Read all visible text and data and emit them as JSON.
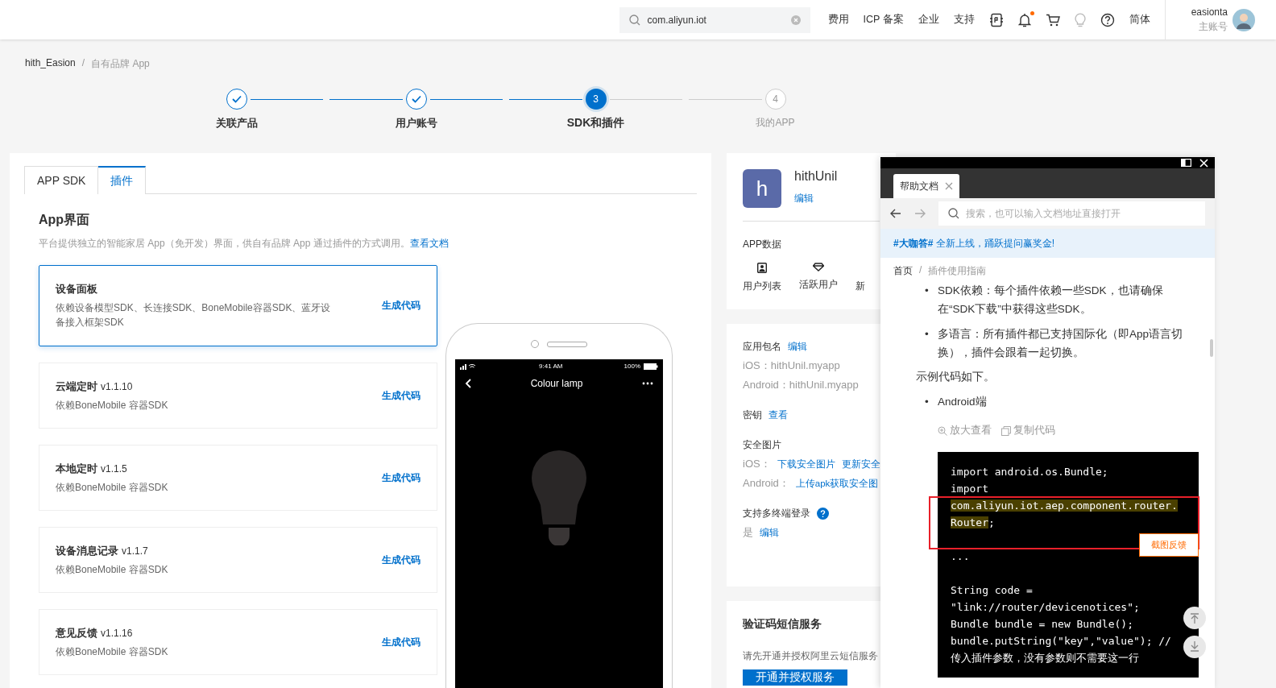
{
  "topbar": {
    "search": {
      "value": "com.aliyun.iot"
    },
    "nav": [
      "费用",
      "ICP 备案",
      "企业",
      "支持"
    ],
    "notification_dot": true,
    "language": "简体",
    "user": {
      "name": "easionta",
      "role": "主账号"
    }
  },
  "breadcrumb": {
    "items": [
      "hith_Easion",
      "自有品牌 App"
    ],
    "separator": "/"
  },
  "steps": [
    {
      "label": "关联产品",
      "kind": "done"
    },
    {
      "label": "用户账号",
      "kind": "done"
    },
    {
      "label": "SDK和插件",
      "kind": "active",
      "number": "3"
    },
    {
      "label": "我的APP",
      "kind": "pending",
      "number": "4"
    }
  ],
  "main": {
    "tabs": [
      {
        "label": "APP SDK",
        "selected": false
      },
      {
        "label": "插件",
        "selected": true
      }
    ],
    "title": "App界面",
    "description": "平台提供独立的智能家居 App（免开发）界面，供自有品牌 App 通过插件的方式调用。",
    "doc_link": "查看文档",
    "plugins": [
      {
        "name": "设备面板",
        "desc": "依赖设备模型SDK、长连接SDK、BoneMobile容器SDK、蓝牙设备接入框架SDK",
        "action": "生成代码",
        "selected": true
      },
      {
        "name": "云端定时",
        "version": "v1.1.10",
        "desc": "依赖BoneMobile 容器SDK",
        "action": "生成代码",
        "selected": false
      },
      {
        "name": "本地定时",
        "version": "v1.1.5",
        "desc": "依赖BoneMobile 容器SDK",
        "action": "生成代码",
        "selected": false
      },
      {
        "name": "设备消息记录",
        "version": "v1.1.7",
        "desc": "依赖BoneMobile 容器SDK",
        "action": "生成代码",
        "selected": false
      },
      {
        "name": "意见反馈",
        "version": "v1.1.16",
        "desc": "依赖BoneMobile 容器SDK",
        "action": "生成代码",
        "selected": false
      }
    ],
    "phone": {
      "time": "9:41 AM",
      "battery": "100%",
      "title": "Colour lamp"
    }
  },
  "app_card": {
    "initial": "h",
    "name": "hithUnil",
    "edit": "编辑",
    "data_title": "APP数据",
    "data_items": [
      {
        "kind": "users",
        "label": "用户列表"
      },
      {
        "kind": "active",
        "label": "活跃用户"
      },
      {
        "kind": "none",
        "label": "新"
      }
    ]
  },
  "config_card": {
    "package": {
      "label": "应用包名",
      "edit": "编辑",
      "ios": "iOS：hithUnil.myapp",
      "android": "Android：hithUnil.myapp"
    },
    "key": {
      "label": "密钥",
      "action": "查看"
    },
    "security_image": {
      "label": "安全图片",
      "ios_label": "iOS：",
      "ios_links": [
        "下载安全图片",
        "更新安全"
      ],
      "android_label": "Android：",
      "android_link": "上传apk获取安全图"
    },
    "multi_login": {
      "label": "支持多终端登录",
      "value": "是",
      "edit": "编辑"
    }
  },
  "sms_card": {
    "title": "验证码短信服务",
    "desc": "请先开通并授权阿里云短信服务",
    "button": "开通并授权服务"
  },
  "help_panel": {
    "tab": "帮助文档",
    "search_placeholder": "搜索，也可以输入文档地址直接打开",
    "banner": "**#大咖答#** 全新上线，踊跃提问赢奖金!",
    "breadcrumb": {
      "items": [
        "首页",
        "插件使用指南"
      ],
      "separator": "/"
    },
    "bullets": [
      {
        "marker": "•",
        "text": "SDK依赖：每个插件依赖一些SDK，也请确保在“SDK下载”中获得这些SDK。"
      },
      {
        "marker": "•",
        "text": "多语言：所有插件都已支持国际化（即App语言切换），插件会跟着一起切换。"
      }
    ],
    "intro": "示例代码如下。",
    "platform": {
      "marker": "•",
      "text": "Android端"
    },
    "tools": [
      "放大查看",
      "复制代码"
    ],
    "code": [
      {
        "segments": [
          {
            "text": "import android.os.Bundle;",
            "highlight": false
          }
        ]
      },
      {
        "segments": [
          {
            "text": "import",
            "highlight": false
          }
        ]
      },
      {
        "segments": [
          {
            "text": "com.aliyun.iot.aep.component.router.",
            "highlight": true
          }
        ]
      },
      {
        "segments": [
          {
            "text": "Router",
            "highlight": true
          },
          {
            "text": ";",
            "highlight": false
          }
        ]
      },
      {
        "space_before": true,
        "segments": [
          {
            "text": "...",
            "highlight": false
          }
        ]
      },
      {
        "space_before": true,
        "segments": [
          {
            "text": "String code =",
            "highlight": false
          }
        ]
      },
      {
        "segments": [
          {
            "text": "\"link://router/devicenotices\";",
            "highlight": false
          }
        ]
      },
      {
        "segments": [
          {
            "text": "Bundle bundle = new Bundle();",
            "highlight": false
          }
        ]
      },
      {
        "segments": [
          {
            "text": "bundle.putString(\"key\",\"value\"); //",
            "highlight": false
          }
        ]
      },
      {
        "segments": [
          {
            "text": "传入插件参数，没有参数则不需要这一行",
            "highlight": false
          }
        ]
      }
    ],
    "feedback": "截图反馈"
  }
}
